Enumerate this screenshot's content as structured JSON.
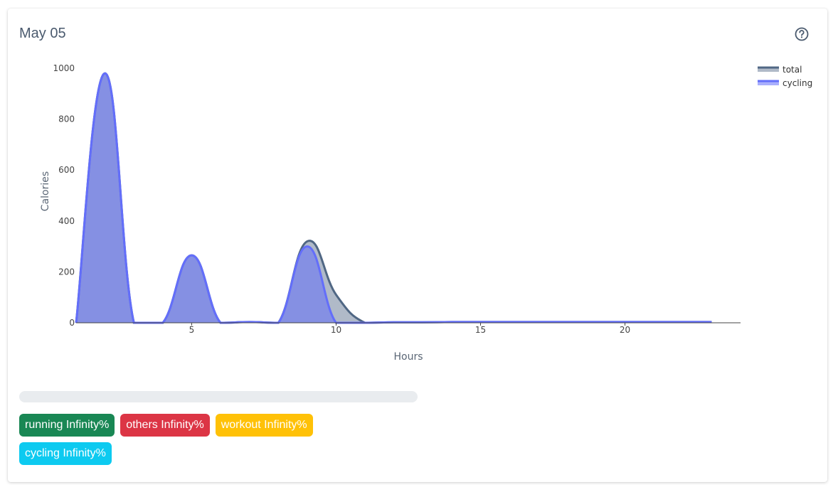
{
  "header": {
    "title": "May 05",
    "help_icon": "question-circle-icon"
  },
  "chart_data": {
    "type": "area",
    "title": "",
    "xlabel": "Hours",
    "ylabel": "Calories",
    "xlim": [
      1,
      24
    ],
    "ylim": [
      0,
      1000
    ],
    "x_ticks": [
      5,
      10,
      15,
      20
    ],
    "y_ticks": [
      0,
      200,
      400,
      600,
      800,
      1000
    ],
    "grid": false,
    "legend_position": "top-right",
    "series": [
      {
        "name": "total",
        "color": "#506784",
        "fill": "rgba(80,103,132,0.45)",
        "x": [
          1,
          2,
          3,
          4,
          5,
          6,
          7,
          8,
          9,
          10,
          11,
          12,
          13,
          14,
          15,
          16,
          17,
          18,
          19,
          20,
          21,
          22,
          23
        ],
        "y": [
          0,
          980,
          0,
          0,
          265,
          0,
          3,
          0,
          320,
          110,
          0,
          2,
          2,
          3,
          3,
          3,
          3,
          3,
          3,
          3,
          3,
          3,
          3
        ]
      },
      {
        "name": "cycling",
        "color": "#636efa",
        "fill": "rgba(99,110,250,0.55)",
        "x": [
          1,
          2,
          3,
          4,
          5,
          6,
          7,
          8,
          9,
          10,
          11,
          12,
          13,
          14,
          15,
          16,
          17,
          18,
          19,
          20,
          21,
          22,
          23
        ],
        "y": [
          0,
          980,
          0,
          0,
          265,
          0,
          3,
          0,
          300,
          0,
          0,
          2,
          2,
          3,
          3,
          3,
          3,
          3,
          3,
          3,
          3,
          3,
          3
        ]
      }
    ]
  },
  "progress": {
    "value": 0
  },
  "badges": {
    "running": "running Infinity%",
    "others": "others Infinity%",
    "workout": "workout Infinity%",
    "cycling": "cycling Infinity%"
  }
}
